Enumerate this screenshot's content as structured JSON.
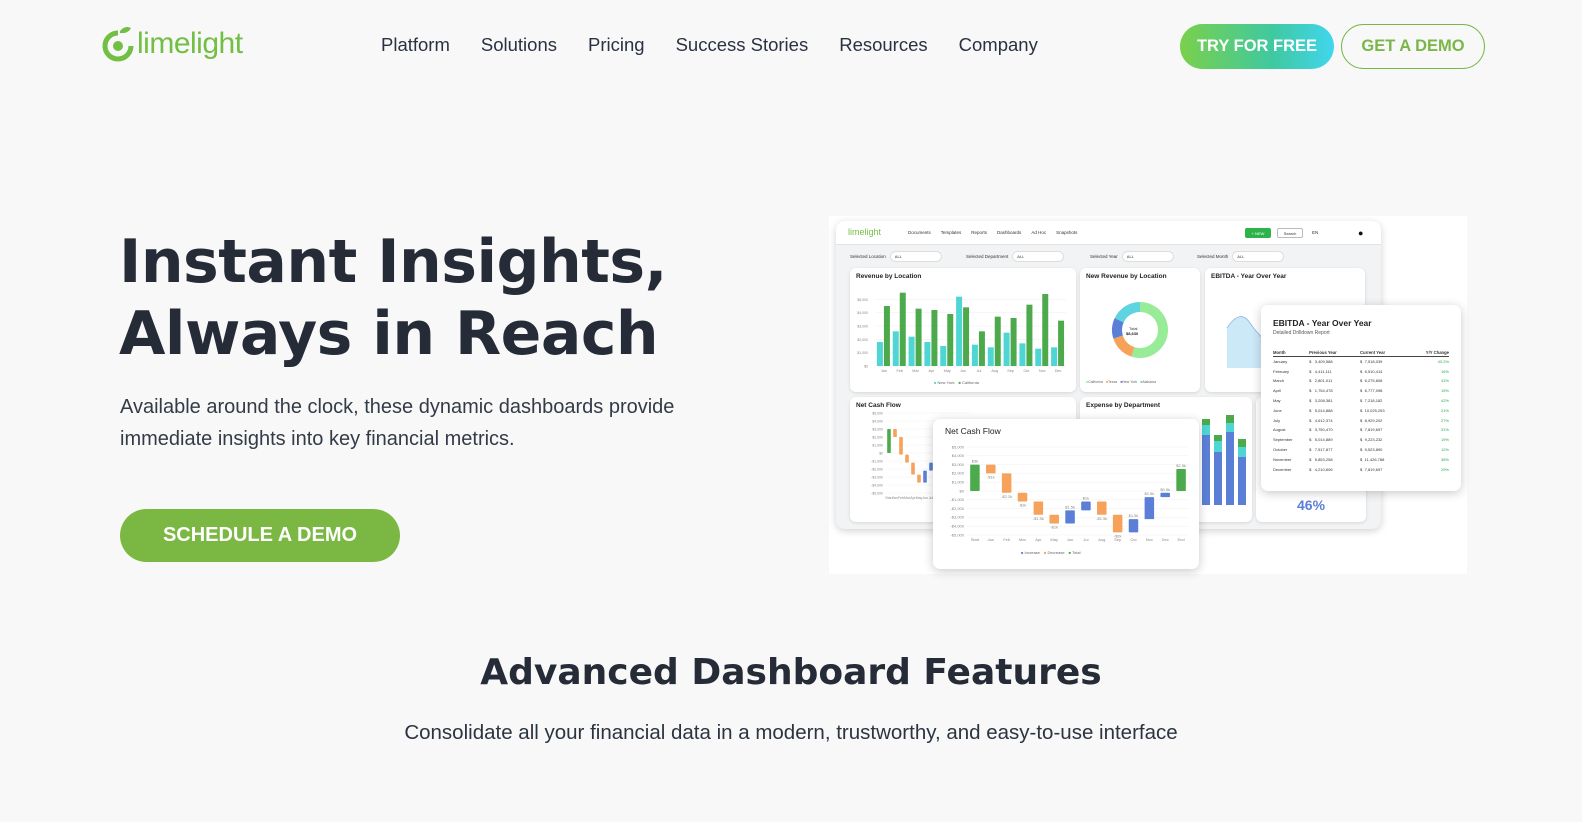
{
  "header": {
    "logo_text": "limelight",
    "nav": [
      "Platform",
      "Solutions",
      "Pricing",
      "Success Stories",
      "Resources",
      "Company"
    ],
    "try_button": "TRY FOR FREE",
    "demo_button": "GET A DEMO"
  },
  "hero": {
    "title_line1": "Instant Insights,",
    "title_line2": "Always in Reach",
    "subtitle": "Available around the clock, these dynamic dashboards provide immediate insights into key financial metrics.",
    "cta": "SCHEDULE A DEMO"
  },
  "features": {
    "title": "Advanced Dashboard Features",
    "subtitle": "Consolidate all your financial data in a modern, trustworthy, and easy-to-use interface"
  },
  "dashboard": {
    "logo": "limelight",
    "nav": [
      "Documents",
      "Templates",
      "Reports",
      "Dashboards",
      "Ad Hoc",
      "Snapshots"
    ],
    "new_button": "+ NEW",
    "search_button": "Search",
    "lang": "EN",
    "filters": [
      {
        "label": "Selected Location",
        "value": "ALL"
      },
      {
        "label": "Selected Department",
        "value": "ALL"
      },
      {
        "label": "Selected Year",
        "value": "ALL"
      },
      {
        "label": "Selected Month",
        "value": "ALL"
      }
    ],
    "revenue_title": "Revenue by Location",
    "new_revenue_title": "New Revenue by Location",
    "ebitda_title": "EBITDA - Year Over Year",
    "net_cash_title": "Net Cash Flow",
    "expense_title": "Expense by Department",
    "donut_total_label": "Total",
    "donut_total_value": "$8,630",
    "donut_legend": [
      "California",
      "Texas",
      "New York",
      "Alabama"
    ],
    "revenue_legend": [
      "New York",
      "California"
    ],
    "cash_legend": [
      "Increase",
      "Decrease",
      "Total"
    ],
    "ebitda_popup_title": "EBITDA - Year Over Year",
    "ebitda_popup_sub": "Detailed Drilldown Report",
    "ebitda_table": {
      "headers": [
        "Month",
        "Previous Year",
        "Current Year",
        "Y/Y Change"
      ],
      "rows": [
        [
          "January",
          "$",
          "3,409,588",
          "$",
          "7,518,039",
          "43.2%"
        ],
        [
          "February",
          "$",
          "4,411,111",
          "$",
          "6,510,414",
          "16%"
        ],
        [
          "March",
          "$",
          "2,801,011",
          "$",
          "6,275,808",
          "41%"
        ],
        [
          "April",
          "$",
          "1,754,478",
          "$",
          "6,777,098",
          "15%"
        ],
        [
          "May",
          "$",
          "3,208,381",
          "$",
          "7,218,182",
          "42%"
        ],
        [
          "June",
          "$",
          "5,014,888",
          "$",
          "10,025,253",
          "21%"
        ],
        [
          "July",
          "$",
          "4,612,374",
          "$",
          "8,929,202",
          "27%"
        ],
        [
          "August",
          "$",
          "3,750,470",
          "$",
          "7,819,697",
          "31%"
        ],
        [
          "September",
          "$",
          "5,014,889",
          "$",
          "9,223,232",
          "19%"
        ],
        [
          "October",
          "$",
          "7,517,877",
          "$",
          "9,523,890",
          "12%"
        ],
        [
          "November",
          "$",
          "5,853,258",
          "$",
          "11,426,788",
          "36%"
        ],
        [
          "December",
          "$",
          "4,210,606",
          "$",
          "7,819,697",
          "29%"
        ]
      ]
    },
    "expense_pct": "46%",
    "months": [
      "Jan",
      "Feb",
      "Mar",
      "Apr",
      "May",
      "Jun",
      "Jul",
      "Aug",
      "Sep",
      "Oct",
      "Nov",
      "Dec"
    ]
  },
  "chart_data": [
    {
      "type": "bar",
      "title": "Revenue by Location",
      "categories": [
        "Jan",
        "Feb",
        "Mar",
        "Apr",
        "May",
        "Jun",
        "Jul",
        "Aug",
        "Sep",
        "Oct",
        "Nov",
        "Dec"
      ],
      "series": [
        {
          "name": "New York",
          "values": [
            1800,
            2600,
            2200,
            1800,
            1500,
            5200,
            1600,
            1400,
            2500,
            1700,
            1300,
            1400
          ]
        },
        {
          "name": "California",
          "values": [
            4500,
            5500,
            4300,
            4200,
            3900,
            4400,
            2600,
            3700,
            3600,
            4600,
            5400,
            3400
          ]
        }
      ],
      "colors": {
        "New York": "#4fd6d4",
        "California": "#4caa4c"
      },
      "ylim": [
        0,
        6000
      ]
    },
    {
      "type": "pie",
      "title": "New Revenue by Location",
      "categories": [
        "California",
        "Texas",
        "New York",
        "Alabama"
      ],
      "values": [
        55,
        15,
        12,
        18
      ],
      "colors": [
        "#98ec98",
        "#f6a25a",
        "#5b7fd6",
        "#5fd3e0"
      ]
    },
    {
      "type": "bar",
      "title": "Net Cash Flow",
      "categories": [
        "Start",
        "Jan",
        "Feb",
        "Mar",
        "Apr",
        "May",
        "Jun",
        "Jul",
        "Aug",
        "Sep",
        "Oct",
        "Nov",
        "Dec",
        "End"
      ],
      "kind": [
        "total",
        "decrease",
        "decrease",
        "decrease",
        "decrease",
        "decrease",
        "increase",
        "increase",
        "decrease",
        "decrease",
        "increase",
        "increase",
        "increase",
        "total"
      ],
      "values": [
        3000,
        -1000,
        -2200,
        -1000,
        -1500,
        -1000,
        1500,
        1000,
        -1500,
        -2000,
        1500,
        2500,
        500,
        2500
      ],
      "labels": [
        "$3k",
        "-$1k",
        "-$2.2k",
        "-$1k",
        "-$1.5k",
        "-$1k",
        "$1.5k",
        "$1k",
        "-$1.5k",
        "-$2k",
        "$1.5k",
        "$2.5k",
        "$0.5k",
        "$2.5k"
      ],
      "colors": {
        "increase": "#5b7fd6",
        "decrease": "#f6a25a",
        "total": "#4caa4c"
      },
      "ylim": [
        -5000,
        5000
      ]
    }
  ]
}
